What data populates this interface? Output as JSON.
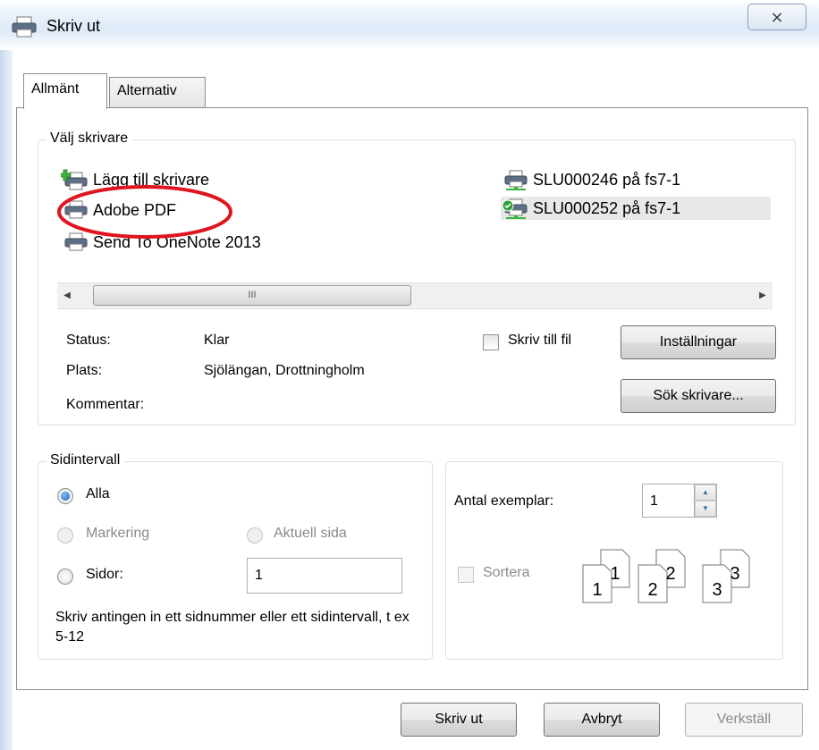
{
  "window": {
    "title": "Skriv ut",
    "close_glyph": "⨯"
  },
  "tabs": [
    {
      "label": "Allmänt",
      "active": true
    },
    {
      "label": "Alternativ",
      "active": false
    }
  ],
  "printer_group": {
    "legend": "Välj skrivare",
    "printers": [
      {
        "name": "Lägg till skrivare",
        "icon": "add-printer-icon"
      },
      {
        "name": "Adobe PDF",
        "icon": "printer-icon"
      },
      {
        "name": "Send To OneNote 2013",
        "icon": "printer-icon"
      },
      {
        "name": "SLU000246 på fs7-1",
        "icon": "network-printer-icon"
      },
      {
        "name": "SLU000252 på fs7-1",
        "icon": "network-printer-default-icon",
        "selected": true
      }
    ],
    "scroll_thumb": "III",
    "status_label": "Status:",
    "status_value": "Klar",
    "location_label": "Plats:",
    "location_value": "Sjölängan, Drottningholm",
    "comment_label": "Kommentar:",
    "print_to_file_label": "Skriv till fil",
    "preferences_button": "Inställningar",
    "find_printer_button": "Sök skrivare..."
  },
  "page_range": {
    "legend": "Sidintervall",
    "all_label": "Alla",
    "selection_label": "Markering",
    "current_page_label": "Aktuell sida",
    "pages_label": "Sidor:",
    "pages_value": "1",
    "hint": "Skriv antingen in ett sidnummer eller ett sidintervall, t ex 5-12"
  },
  "copies": {
    "label": "Antal exemplar:",
    "value": "1",
    "collate_label": "Sortera",
    "collate_pages": [
      "1",
      "2",
      "3"
    ]
  },
  "footer": {
    "print_button": "Skriv ut",
    "cancel_button": "Avbryt",
    "apply_button": "Verkställ"
  },
  "colors": {
    "annotation": "#e0141e",
    "accent": "#1a5fb4"
  }
}
